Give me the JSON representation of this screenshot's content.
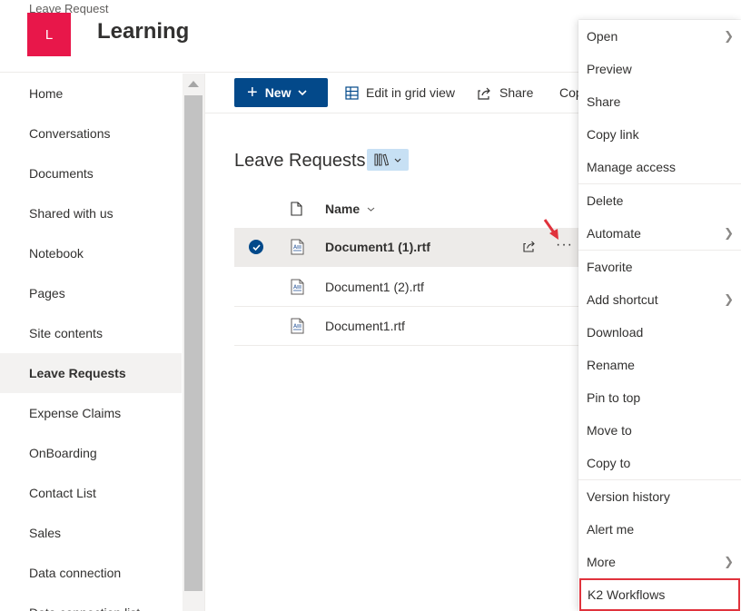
{
  "header": {
    "breadcrumb": "Leave Request",
    "logo_letter": "L",
    "site_title": "Learning",
    "logo_color": "#e8174a"
  },
  "nav": {
    "items": [
      {
        "label": "Home"
      },
      {
        "label": "Conversations"
      },
      {
        "label": "Documents"
      },
      {
        "label": "Shared with us"
      },
      {
        "label": "Notebook"
      },
      {
        "label": "Pages"
      },
      {
        "label": "Site contents"
      },
      {
        "label": "Leave Requests",
        "selected": true
      },
      {
        "label": "Expense Claims"
      },
      {
        "label": "OnBoarding"
      },
      {
        "label": "Contact List"
      },
      {
        "label": "Sales"
      },
      {
        "label": "Data connection"
      },
      {
        "label": "Data connection list"
      }
    ]
  },
  "commandbar": {
    "new_label": "New",
    "grid_label": "Edit in grid view",
    "share_label": "Share",
    "copylink_label": "Copy link",
    "accent": "#03498a"
  },
  "library": {
    "title": "Leave Requests",
    "column_name": "Name",
    "files": [
      {
        "name": "Document1 (1).rtf",
        "selected": true
      },
      {
        "name": "Document1 (2).rtf",
        "selected": false
      },
      {
        "name": "Document1.rtf",
        "selected": false
      }
    ]
  },
  "context_menu": {
    "items": [
      {
        "label": "Open",
        "submenu": true
      },
      {
        "label": "Preview"
      },
      {
        "label": "Share"
      },
      {
        "label": "Copy link"
      },
      {
        "label": "Manage access"
      },
      {
        "label": "Delete"
      },
      {
        "label": "Automate",
        "submenu": true
      },
      {
        "label": "Favorite"
      },
      {
        "label": "Add shortcut",
        "submenu": true
      },
      {
        "label": "Download"
      },
      {
        "label": "Rename"
      },
      {
        "label": "Pin to top"
      },
      {
        "label": "Move to"
      },
      {
        "label": "Copy to"
      },
      {
        "label": "Version history"
      },
      {
        "label": "Alert me"
      },
      {
        "label": "More",
        "submenu": true
      },
      {
        "label": "K2 Workflows",
        "highlighted": true
      }
    ],
    "highlight_color": "#e0323c"
  }
}
